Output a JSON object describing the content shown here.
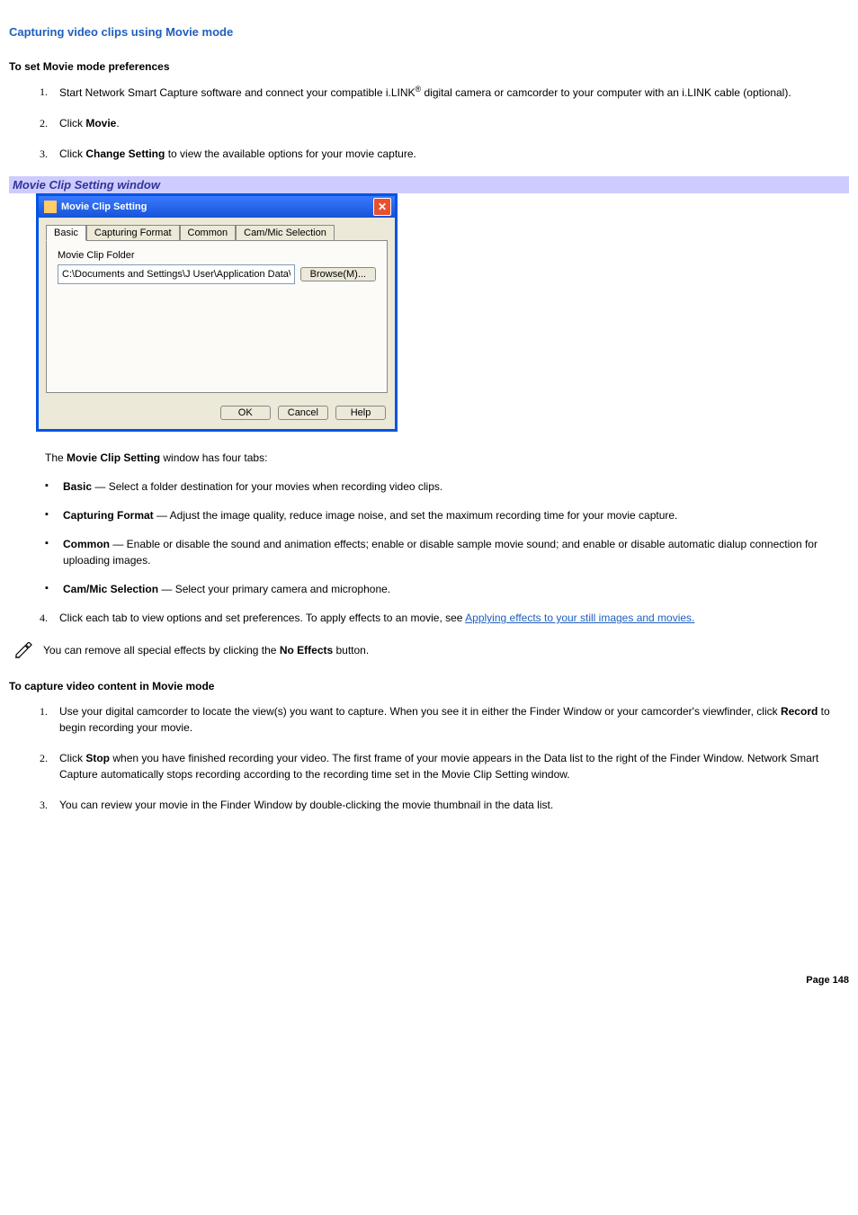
{
  "title": "Capturing video clips using Movie mode",
  "heading1": "To set Movie mode preferences",
  "steps1": {
    "s1a": "Start Network Smart Capture software and connect your compatible i.LINK",
    "s1reg": "®",
    "s1b": " digital camera or camcorder to your computer with an i.LINK cable (optional).",
    "s2a": "Click ",
    "s2bold": "Movie",
    "s2b": ".",
    "s3a": "Click ",
    "s3bold": "Change Setting",
    "s3b": " to view the available options for your movie capture."
  },
  "banner": "Movie Clip Setting window",
  "dialog": {
    "title": "Movie Clip Setting",
    "tabs": [
      "Basic",
      "Capturing Format",
      "Common",
      "Cam/Mic Selection"
    ],
    "folder_label": "Movie Clip Folder",
    "folder_value": "C:\\Documents and Settings\\J User\\Application Data\\So",
    "browse": "Browse(M)...",
    "ok": "OK",
    "cancel": "Cancel",
    "help": "Help",
    "close": "✕"
  },
  "tabs_intro_a": "The ",
  "tabs_intro_bold": "Movie Clip Setting",
  "tabs_intro_b": " window has four tabs:",
  "tabdesc": {
    "basic_b": "Basic",
    "basic_t": " — Select a folder destination for your movies when recording video clips.",
    "cf_b": "Capturing Format",
    "cf_t": " — Adjust the image quality, reduce image noise, and set the maximum recording time for your movie capture.",
    "common_b": "Common",
    "common_t": " — Enable or disable the sound and animation effects; enable or disable sample movie sound; and enable or disable automatic dialup connection for uploading images.",
    "cam_b": "Cam/Mic Selection",
    "cam_t": " — Select your primary camera and microphone."
  },
  "s4a": "Click each tab to view options and set preferences. To apply effects to an movie, see ",
  "s4link": "Applying effects to your still images and movies.",
  "note_a": "You can remove all special effects by clicking the ",
  "note_bold": "No Effects",
  "note_b": " button.",
  "heading2": "To capture video content in Movie mode",
  "steps2": {
    "s1a": "Use your digital camcorder to locate the view(s) you want to capture. When you see it in either the Finder Window or your camcorder's viewfinder, click ",
    "s1bold": "Record",
    "s1b": " to begin recording your movie.",
    "s2a": "Click ",
    "s2bold": "Stop",
    "s2b": " when you have finished recording your video. The first frame of your movie appears in the Data list to the right of the Finder Window. Network Smart Capture automatically stops recording according to the recording time set in the Movie Clip Setting window.",
    "s3": "You can review your movie in the Finder Window by double-clicking the movie thumbnail in the data list."
  },
  "footer": "Page 148"
}
